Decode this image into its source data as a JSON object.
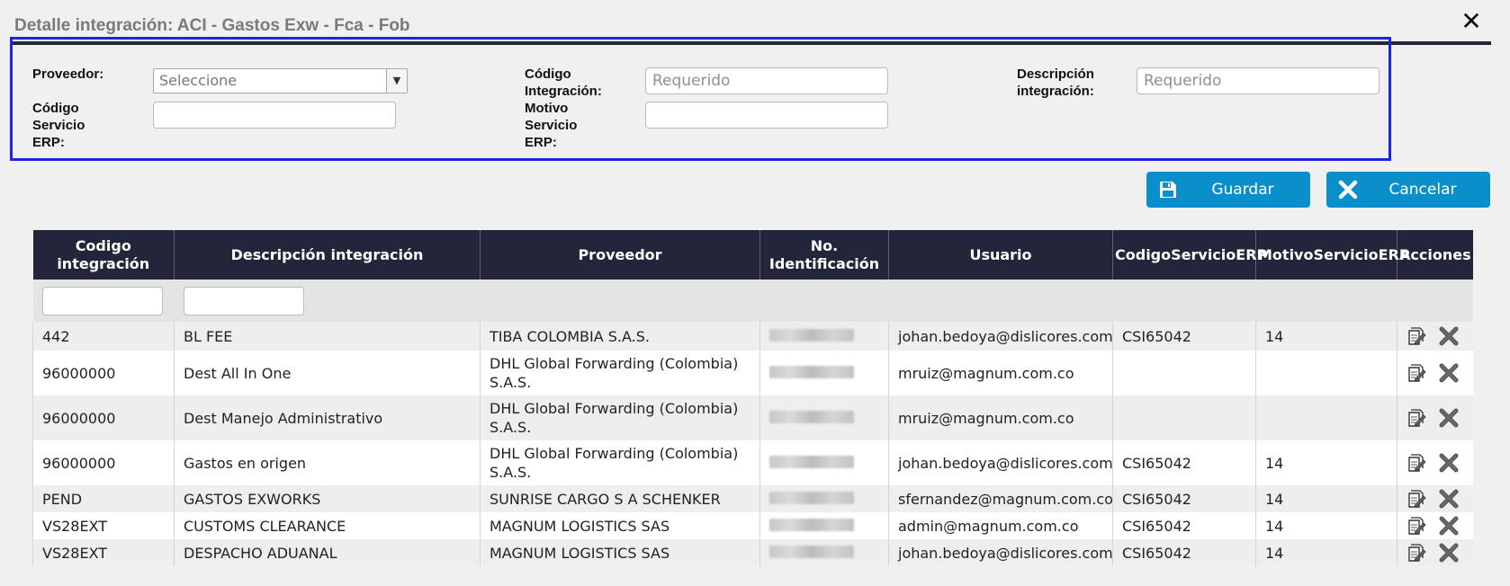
{
  "dialog": {
    "title": "Detalle integración: ACI - Gastos Exw - Fca - Fob",
    "close_label": "✕"
  },
  "form": {
    "proveedor_label": "Proveedor:",
    "proveedor_value": "Seleccione",
    "codigo_integracion_label_1": "Código",
    "codigo_integracion_label_2": "Integración:",
    "codigo_integracion_placeholder": "Requerido",
    "descripcion_label_1": "Descripción",
    "descripcion_label_2": "integración:",
    "descripcion_placeholder": "Requerido",
    "codigo_servicio_label_1": "Código",
    "codigo_servicio_label_2": "Servicio",
    "codigo_servicio_label_3": "ERP:",
    "codigo_servicio_value": "",
    "motivo_servicio_label_1": "Motivo",
    "motivo_servicio_label_2": "Servicio",
    "motivo_servicio_label_3": "ERP:",
    "motivo_servicio_value": ""
  },
  "actions": {
    "save_label": "Guardar",
    "cancel_label": "Cancelar"
  },
  "table": {
    "headers": {
      "codigo_1": "Codigo",
      "codigo_2": "integración",
      "descripcion": "Descripción integración",
      "proveedor": "Proveedor",
      "noid_1": "No.",
      "noid_2": "Identificación",
      "usuario": "Usuario",
      "codservicio": "CodigoServicioERP",
      "motservicio": "MotivoServicioERP",
      "acciones": "Acciones"
    },
    "rows": [
      {
        "codigo": "442",
        "descripcion": "BL FEE",
        "proveedor": "TIBA COLOMBIA S.A.S.",
        "usuario": "johan.bedoya@dislicores.com",
        "codservicio": "CSI65042",
        "motservicio": "14"
      },
      {
        "codigo": "96000000",
        "descripcion": "Dest All In One",
        "proveedor": "DHL Global Forwarding (Colombia) S.A.S.",
        "usuario": "mruiz@magnum.com.co",
        "codservicio": "",
        "motservicio": ""
      },
      {
        "codigo": "96000000",
        "descripcion": "Dest Manejo Administrativo",
        "proveedor": "DHL Global Forwarding (Colombia) S.A.S.",
        "usuario": "mruiz@magnum.com.co",
        "codservicio": "",
        "motservicio": ""
      },
      {
        "codigo": "96000000",
        "descripcion": "Gastos en origen",
        "proveedor": "DHL Global Forwarding (Colombia) S.A.S.",
        "usuario": "johan.bedoya@dislicores.com",
        "codservicio": "CSI65042",
        "motservicio": "14"
      },
      {
        "codigo": "PEND",
        "descripcion": "GASTOS EXWORKS",
        "proveedor": "SUNRISE CARGO S A SCHENKER",
        "usuario": "sfernandez@magnum.com.co",
        "codservicio": "CSI65042",
        "motservicio": "14"
      },
      {
        "codigo": "VS28EXT",
        "descripcion": "CUSTOMS CLEARANCE",
        "proveedor": "MAGNUM LOGISTICS SAS",
        "usuario": "admin@magnum.com.co",
        "codservicio": "CSI65042",
        "motservicio": "14"
      },
      {
        "codigo": "VS28EXT",
        "descripcion": "DESPACHO ADUANAL",
        "proveedor": "MAGNUM LOGISTICS SAS",
        "usuario": "johan.bedoya@dislicores.com",
        "codservicio": "CSI65042",
        "motservicio": "14"
      }
    ]
  },
  "icons": {
    "save": "floppy-disk-icon",
    "cancel": "x-icon",
    "edit": "edit-document-icon",
    "delete": "delete-x-icon"
  },
  "colors": {
    "header_bg": "#23263a",
    "button_bg": "#0a8fca",
    "panel_border": "#1f24e0"
  }
}
